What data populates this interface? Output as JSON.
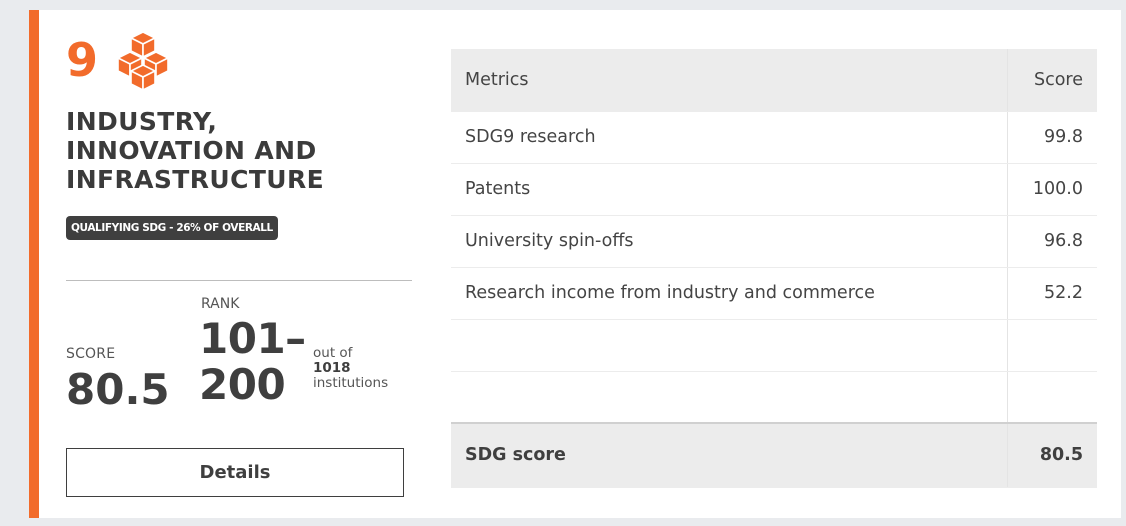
{
  "goal": {
    "number": "9",
    "icon": "cubes-icon",
    "title_lines": [
      "INDUSTRY,",
      "INNOVATION AND",
      "INFRASTRUCTURE"
    ],
    "badge": "QUALIFYING SDG - 26% OF OVERALL",
    "accent_color": "#f26b2b"
  },
  "summary": {
    "score_label": "SCORE",
    "score_value": "80.5",
    "rank_label": "RANK",
    "rank_line1": "101–",
    "rank_line2": "200",
    "out_of_pre": "out of",
    "out_of_count": "1018",
    "out_of_post": "institutions"
  },
  "details_button": "Details",
  "metrics_table": {
    "headers": [
      "Metrics",
      "Score"
    ],
    "rows": [
      {
        "metric": "SDG9 research",
        "score": "99.8"
      },
      {
        "metric": "Patents",
        "score": "100.0"
      },
      {
        "metric": "University spin-offs",
        "score": "96.8"
      },
      {
        "metric": "Research income from industry and commerce",
        "score": "52.2"
      },
      {
        "metric": "",
        "score": ""
      },
      {
        "metric": "",
        "score": ""
      }
    ],
    "footer": {
      "label": "SDG score",
      "score": "80.5"
    }
  }
}
